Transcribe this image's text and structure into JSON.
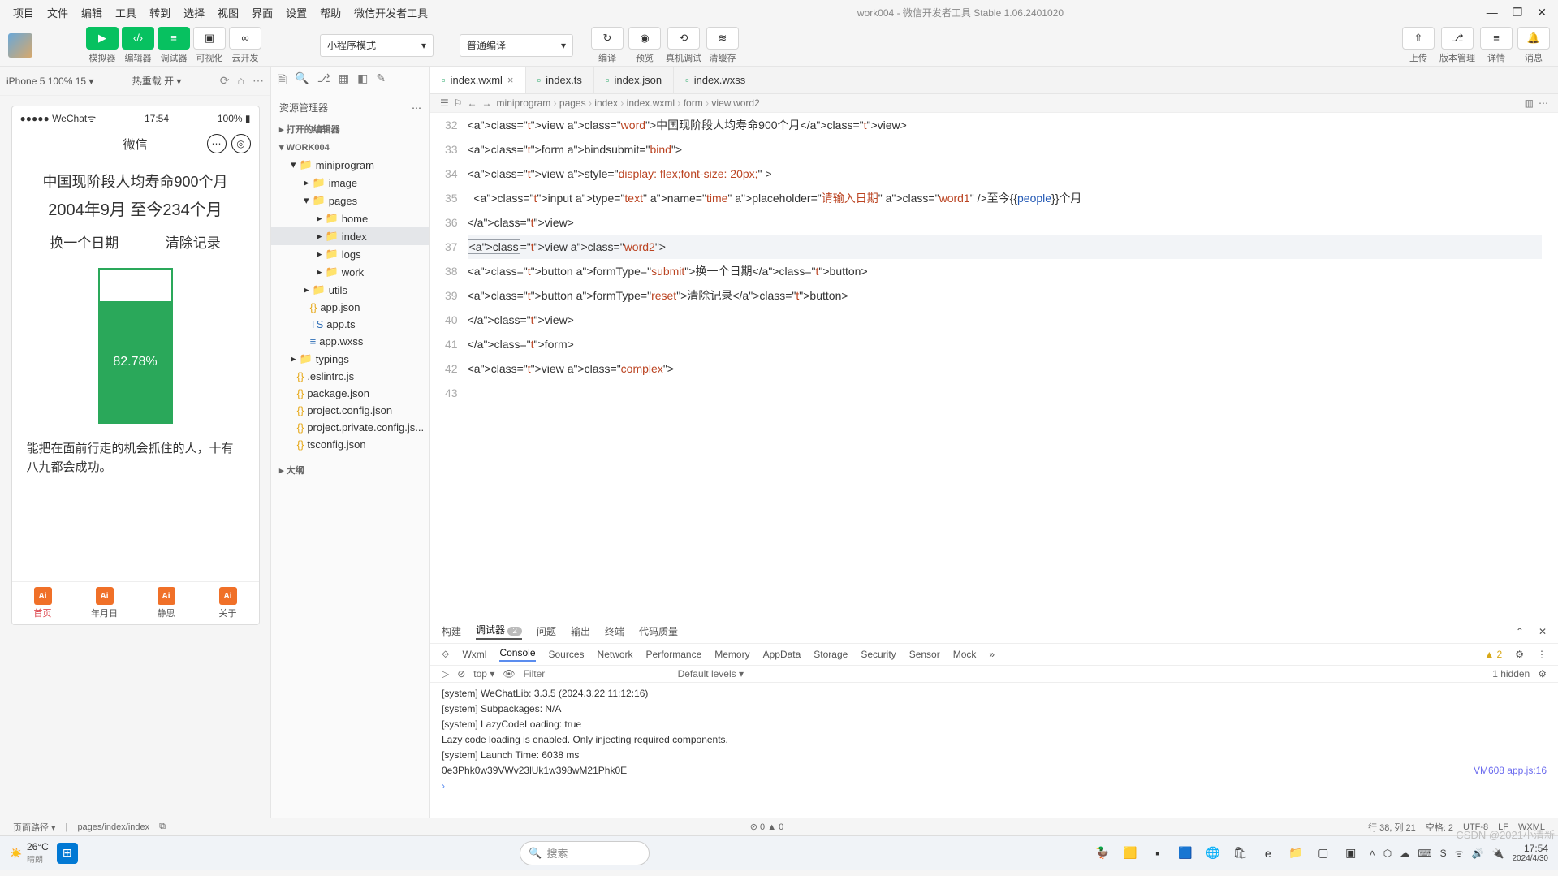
{
  "window": {
    "title": "work004 - 微信开发者工具 Stable 1.06.2401020",
    "menus": [
      "项目",
      "文件",
      "编辑",
      "工具",
      "转到",
      "选择",
      "视图",
      "界面",
      "设置",
      "帮助",
      "微信开发者工具"
    ],
    "win_min": "—",
    "win_max": "❐",
    "win_close": "✕"
  },
  "toolbar": {
    "groups": {
      "sim": "模拟器",
      "editor": "编辑器",
      "debug": "调试器",
      "visual": "可视化",
      "cloud": "云开发"
    },
    "mode": {
      "label": "小程序模式",
      "arrow": "▾"
    },
    "compile": {
      "label": "普通编译",
      "arrow": "▾"
    },
    "actions": {
      "compile": "编译",
      "preview": "预览",
      "remote": "真机调试",
      "clear": "清缓存"
    },
    "right": {
      "upload": "上传",
      "version": "版本管理",
      "detail": "详情",
      "msg": "消息"
    }
  },
  "simHead": {
    "device": "iPhone 5 100% 15 ▾",
    "reload": "热重载 开 ▾"
  },
  "phone": {
    "signal": "●●●●● WeChat",
    "wifi": "ᯤ",
    "time": "17:54",
    "batt": "100%",
    "navTitle": "微信",
    "word": "中国现阶段人均寿命900个月",
    "word1": "2004年9月   至今234个月",
    "btn1": "换一个日期",
    "btn2": "清除记录",
    "percent": "82.78%",
    "quote": "能把在面前行走的机会抓住的人，十有八九都会成功。",
    "tabs": [
      "首页",
      "年月日",
      "静思",
      "关于"
    ]
  },
  "explorer": {
    "title": "资源管理器",
    "more": "⋯",
    "sec1": "打开的编辑器",
    "sec2": "WORK004",
    "outline": "大纲",
    "tree": [
      {
        "d": 1,
        "t": "fold",
        "arr": "▾",
        "n": "miniprogram"
      },
      {
        "d": 2,
        "t": "fold",
        "arr": "▸",
        "n": "image"
      },
      {
        "d": 2,
        "t": "fold",
        "arr": "▾",
        "n": "pages"
      },
      {
        "d": 3,
        "t": "fold",
        "arr": "▸",
        "n": "home"
      },
      {
        "d": 3,
        "t": "fold",
        "arr": "▸",
        "n": "index",
        "sel": true
      },
      {
        "d": 3,
        "t": "fold",
        "arr": "▸",
        "n": "logs"
      },
      {
        "d": 3,
        "t": "fold",
        "arr": "▸",
        "n": "work"
      },
      {
        "d": 2,
        "t": "fold",
        "arr": "▸",
        "n": "utils"
      },
      {
        "d": 2,
        "t": "json",
        "n": "app.json"
      },
      {
        "d": 2,
        "t": "ts",
        "n": "app.ts"
      },
      {
        "d": 2,
        "t": "wxss",
        "n": "app.wxss"
      },
      {
        "d": 1,
        "t": "fold",
        "arr": "▸",
        "n": "typings"
      },
      {
        "d": 1,
        "t": "json",
        "n": ".eslintrc.js"
      },
      {
        "d": 1,
        "t": "json",
        "n": "package.json"
      },
      {
        "d": 1,
        "t": "json",
        "n": "project.config.json"
      },
      {
        "d": 1,
        "t": "json",
        "n": "project.private.config.js..."
      },
      {
        "d": 1,
        "t": "json",
        "n": "tsconfig.json"
      }
    ]
  },
  "editor": {
    "tabs": [
      {
        "ico": "wxml",
        "label": "index.wxml",
        "close": "×",
        "active": true
      },
      {
        "ico": "ts",
        "label": "index.ts"
      },
      {
        "ico": "json",
        "label": "index.json"
      },
      {
        "ico": "wxss",
        "label": "index.wxss"
      }
    ],
    "crumbs": [
      "miniprogram",
      "pages",
      "index",
      "index.wxml",
      "form",
      "view.word2"
    ],
    "startLine": 32,
    "code": [
      "",
      "<view class=\"word\">中国现阶段人均寿命900个月</view>",
      "<form bindsubmit=\"bind\">",
      "<view style=\"display: flex;font-size: 20px;\" >",
      "  <input type=\"text\" name=\"time\" placeholder=\"请输入日期\" class=\"word1\" />至今{{people}}个月",
      "</view>",
      "<view class=\"word2\">",
      "<button formType=\"submit\">换一个日期</button>",
      "<button formType=\"reset\">清除记录</button>",
      "</view>",
      "</form>",
      "<view class=\"complex\">"
    ]
  },
  "bottom": {
    "tabs": [
      "构建",
      "调试器",
      "问题",
      "输出",
      "终端",
      "代码质量"
    ],
    "active": 1,
    "badge": "2",
    "devtabs": [
      "Wxml",
      "Console",
      "Sources",
      "Network",
      "Performance",
      "Memory",
      "AppData",
      "Storage",
      "Security",
      "Sensor",
      "Mock"
    ],
    "devactive": 1,
    "warn": "▲ 2",
    "hidden": "1 hidden",
    "filter": {
      "scope": "top",
      "arrow": "▾",
      "placeholder": "Filter",
      "level": "Default levels ▾"
    },
    "lines": [
      "[system] WeChatLib: 3.3.5 (2024.3.22 11:12:16)",
      "[system] Subpackages: N/A",
      "[system] LazyCodeLoading: true",
      "Lazy code loading is enabled. Only injecting required components.",
      "[system] Launch Time: 6038 ms",
      "0e3Phk0w39VWv23lUk1w398wM21Phk0E"
    ],
    "link": "VM608 app.js:16",
    "prompt": "›"
  },
  "status": {
    "left1": "页面路径 ▾",
    "left2": "pages/index/index",
    "err": "⊘ 0 ▲ 0",
    "pos": "行 38, 列 21",
    "spaces": "空格: 2",
    "enc": "UTF-8",
    "eol": "LF",
    "lang": "WXML"
  },
  "taskbar": {
    "temp": "26°C",
    "cond": "晴朗",
    "search": "搜索",
    "time": "17:54",
    "date": "2024/4/30",
    "watermark": "CSDN @2021小清新"
  }
}
